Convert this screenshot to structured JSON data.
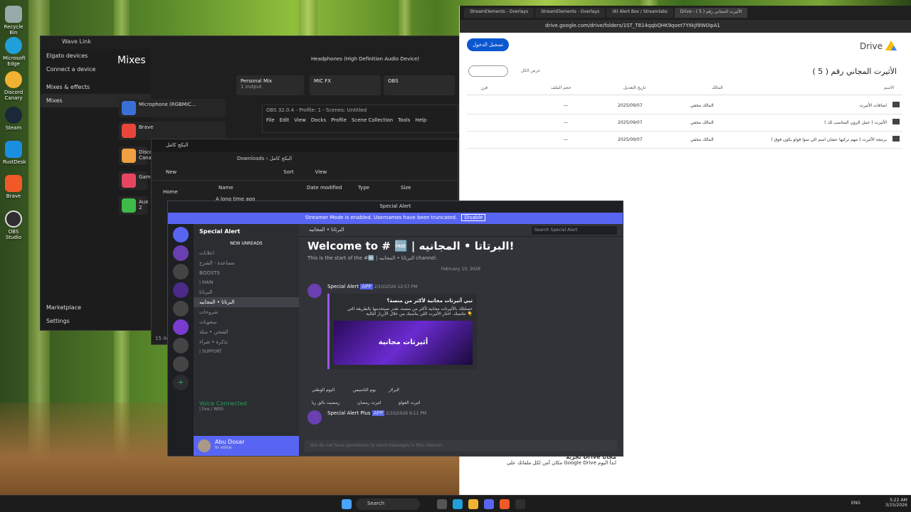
{
  "desktop": {
    "icons": [
      "Recycle Bin",
      "Microsoft Edge",
      "Discord Canary",
      "Steam",
      "RustDesk",
      "Brave",
      "OBS Studio"
    ]
  },
  "wavelink": {
    "title": "Wave Link",
    "side_items": [
      "Elgato devices",
      "Connect a device",
      "Mixes & effects",
      "Mixes",
      "Marketplace",
      "Settings"
    ],
    "heading": "Mixes",
    "device": "Headphones (High Definition Audio Device)",
    "cards": [
      "Personal Mix",
      "1 output",
      "MIC FX",
      "OBS"
    ],
    "channels": [
      "Microphone (RGBMIC...",
      "Brave",
      "Disco Canar",
      "Game",
      "Aux 2"
    ],
    "colors": {
      "mic": "#3b6fd8",
      "brave": "#e8463a",
      "discord": "#f0a040",
      "game": "#e84560",
      "aux": "#3fb94a"
    }
  },
  "obs": {
    "title": "OBS 32.0.4 - Profile: 1 - Scenes: Untitled",
    "menu": [
      "File",
      "Edit",
      "View",
      "Docks",
      "Profile",
      "Scene Collection",
      "Tools",
      "Help"
    ]
  },
  "explorer": {
    "tab": "البكج كامل",
    "path": [
      "Downloads",
      "البكج كامل"
    ],
    "toolbar": [
      "New",
      "Sort",
      "View"
    ],
    "columns": [
      "Name",
      "Date modified",
      "Type",
      "Size"
    ],
    "side": [
      "Home"
    ],
    "row": "A long time ago",
    "count": "15 item"
  },
  "drive": {
    "tabs": [
      "StreamElements - Overlays",
      "StreamElements - Overlays",
      "(6) Alert Box / Streamlabs",
      "Drive - الأثيرت المجاني رقم ( 5 )"
    ],
    "url": "drive.google.com/drive/folders/1ST_T814qqbQHK9qoet7YIIkJf8W0IpA1",
    "signin": "تسجيل الدخول",
    "logo": "Drive",
    "folder_title": "الأثيرت المجاني رقم ( 5 )",
    "view_details": "عرض الكل",
    "columns": [
      "الاسم",
      "المالك",
      "تاريخ التعديل",
      "حجم الملف",
      "فرز"
    ],
    "rows": [
      {
        "name": "اضافات الأثيرت",
        "owner": "المالك مخفي",
        "date": "2025/09/07",
        "size": "—"
      },
      {
        "name": "الأثيرت ( حمل الزون المناسب لك )",
        "owner": "المالك مخفي",
        "date": "2025/09/07",
        "size": "—"
      },
      {
        "name": "برمجة الأثيرت ( مهم تركيها عشان اسم الي سوا فولو يكون فوق )",
        "owner": "المالك مخفي",
        "date": "2025/09/07",
        "size": "—"
      }
    ],
    "promo_title": "تجربة Drive مجانًا",
    "promo_text": "مكان آمن لكل ملفاتك على Google Drive ابدأ اليوم"
  },
  "discord": {
    "title": "Special Alert",
    "banner": "Streamer Mode is enabled. Usernames have been truncated.",
    "disable": "Disable",
    "server": "Special Alert",
    "channels": [
      "NEW UNREADS",
      "اعلانات",
      "مساعدة - الشرح",
      "BOOSTS",
      "| MAIN",
      "البرتاتا",
      "البرتاتا • المجانيه",
      "شروحات",
      "سحوبات",
      "الشحن • سلة",
      "تذكرة • شراء",
      "| SUPPORT"
    ],
    "channel_header": "البرتاتا • المجانيه",
    "search": "Search Special Alert",
    "welcome": "Welcome to # 🆓 | البرتاتا • المجانيه!",
    "start": "This is the start of the #🆓 | البرتاتا • المجانيه channel.",
    "date": "February 10, 2026",
    "msg1": {
      "author": "Special Alert",
      "tag": "APP",
      "time": "2/10/2026 12:57 PM",
      "title": "تبي أثيرتات مجانية لأكثر من منصة؟",
      "body": "حصلتلك بالأثيرتات مجانية لأكثر من منصة، تقدر تستخدمها بالطريقة التي تناسبك. اختار الأثيرت اللي يناسبك من خلال الأزرار التالية 👇",
      "image": "أثيرتات مجانية",
      "buttons": [
        "البرلار",
        "يوم التاسيس",
        "اليوم الوطني",
        "اثيرت الفولو",
        "اثيرت رمضان",
        "رمضيت بالق ريا"
      ]
    },
    "msg2": {
      "author": "Special Alert Plus",
      "tag": "APP",
      "time": "2/10/2026 6:11 PM"
    },
    "input": "You do not have permission to send messages in this channel.",
    "voice": "Voice Connected",
    "voice_sub": "| live / WSS",
    "user": "Abu Dosar",
    "user_sub": "In voice"
  },
  "taskbar": {
    "search": "Search",
    "lang": "ENG",
    "time": "5:22 AM",
    "date": "3/15/2026"
  }
}
